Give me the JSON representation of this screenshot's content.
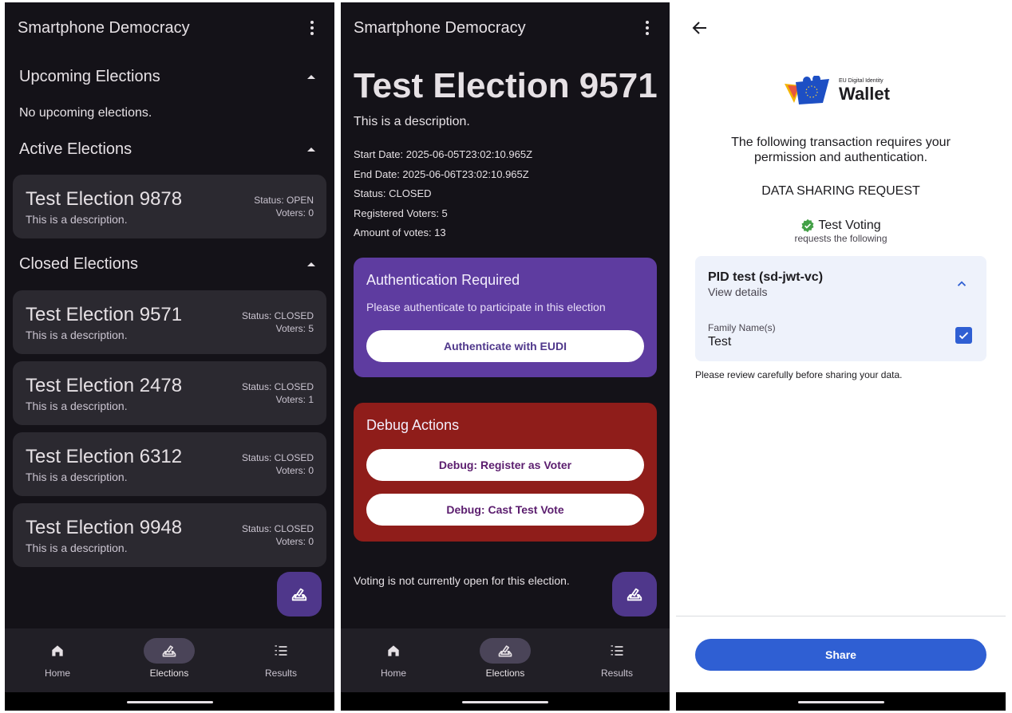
{
  "elections_list": {
    "app_title": "Smartphone Democracy",
    "upcoming": {
      "heading": "Upcoming Elections",
      "empty_text": "No upcoming elections."
    },
    "active": {
      "heading": "Active Elections",
      "items": [
        {
          "title": "Test Election 9878",
          "description": "This is a description.",
          "status": "Status: OPEN",
          "voters": "Voters: 0"
        }
      ]
    },
    "closed": {
      "heading": "Closed Elections",
      "items": [
        {
          "title": "Test Election 9571",
          "description": "This is a description.",
          "status": "Status: CLOSED",
          "voters": "Voters: 5"
        },
        {
          "title": "Test Election 2478",
          "description": "This is a description.",
          "status": "Status: CLOSED",
          "voters": "Voters: 1"
        },
        {
          "title": "Test Election 6312",
          "description": "This is a description.",
          "status": "Status: CLOSED",
          "voters": "Voters: 0"
        },
        {
          "title": "Test Election 9948",
          "description": "This is a description.",
          "status": "Status: CLOSED",
          "voters": "Voters: 0"
        }
      ]
    }
  },
  "election_detail": {
    "app_title": "Smartphone Democracy",
    "title": "Test Election 9571",
    "description": "This is a description.",
    "start_date": "Start Date: 2025-06-05T23:02:10.965Z",
    "end_date": "End Date: 2025-06-06T23:02:10.965Z",
    "status": "Status: CLOSED",
    "registered_voters": "Registered Voters: 5",
    "amount_votes": "Amount of votes: 13",
    "auth_panel": {
      "title": "Authentication Required",
      "subtitle": "Please authenticate to participate in this election",
      "button": "Authenticate with EUDI"
    },
    "debug_panel": {
      "title": "Debug Actions",
      "register_button": "Debug: Register as Voter",
      "cast_button": "Debug: Cast Test Vote"
    },
    "notice": "Voting is not currently open for this election."
  },
  "nav": {
    "home": "Home",
    "elections": "Elections",
    "results": "Results"
  },
  "wallet": {
    "logo_small": "EU Digital Identity",
    "logo_big": "Wallet",
    "permission_line1": "The following transaction requires your",
    "permission_line2": "permission and authentication.",
    "request_heading": "DATA SHARING REQUEST",
    "relying_party": "Test Voting",
    "requests_following": "requests the following",
    "credential_title": "PID test (sd-jwt-vc)",
    "view_details": "View details",
    "field_label": "Family Name(s)",
    "field_value": "Test",
    "review_note": "Please review carefully before sharing your data.",
    "share_button": "Share"
  },
  "colors": {
    "dark_bg": "#141218",
    "card_bg": "#2b2930",
    "fab_bg": "#4f378b",
    "auth_panel_bg": "#5e3ca0",
    "debug_panel_bg": "#8f1d1a",
    "wallet_primary": "#2f5fd3",
    "verified_green": "#43a047"
  },
  "icons": [
    "more-vert-icon",
    "expand-less-icon",
    "ballot-icon",
    "home-icon",
    "list-numbered-icon",
    "arrow-back-icon",
    "eu-wallet-logo",
    "verified-check-icon",
    "chevron-up-icon",
    "checkbox-checked-icon"
  ]
}
